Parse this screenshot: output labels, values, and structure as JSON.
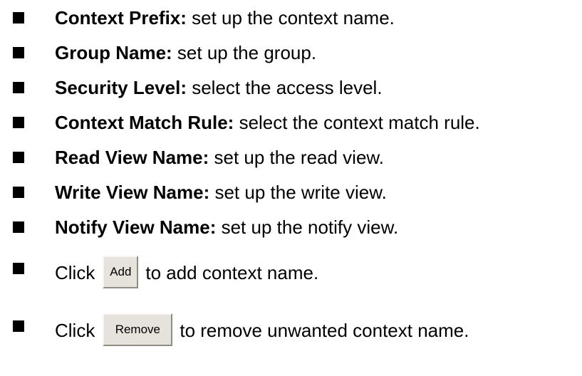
{
  "items": [
    {
      "term": "Context Prefix:",
      "desc": " set up the context name."
    },
    {
      "term": "Group Name:",
      "desc": " set up the group."
    },
    {
      "term": "Security Level:",
      "desc": " select the access level."
    },
    {
      "term": "Context Match Rule:",
      "desc": " select the context match rule."
    },
    {
      "term": "Read View Name:",
      "desc": " set up the read view."
    },
    {
      "term": "Write View Name:",
      "desc": " set up the write view."
    },
    {
      "term": "Notify View Name:",
      "desc": " set up the notify view."
    }
  ],
  "add_item": {
    "prefix": "Click",
    "button_label": "Add",
    "suffix": "to add context name."
  },
  "remove_item": {
    "prefix": "Click",
    "button_label": "Remove",
    "suffix": "to remove unwanted context name."
  },
  "colors": {
    "text": "#000000",
    "bullet": "#000000",
    "button_face": "#e6e3dc"
  }
}
